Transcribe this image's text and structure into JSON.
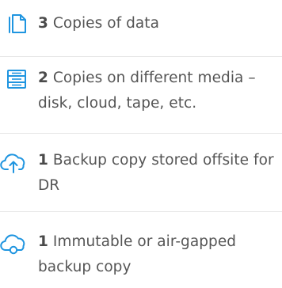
{
  "items": [
    {
      "icon": "copies-icon",
      "number": "3",
      "text": " Copies of data"
    },
    {
      "icon": "media-storage-icon",
      "number": "2",
      "text": " Copies on different media – disk, cloud, tape, etc."
    },
    {
      "icon": "cloud-upload-icon",
      "number": "1",
      "text": " Backup copy stored offsite for DR"
    },
    {
      "icon": "cloud-sync-icon",
      "number": "1",
      "text": " Immutable or air-gapped backup copy"
    }
  ],
  "colors": {
    "icon_accent": "#1f95e0",
    "text": "#555555",
    "number": "#4a4a4a"
  }
}
